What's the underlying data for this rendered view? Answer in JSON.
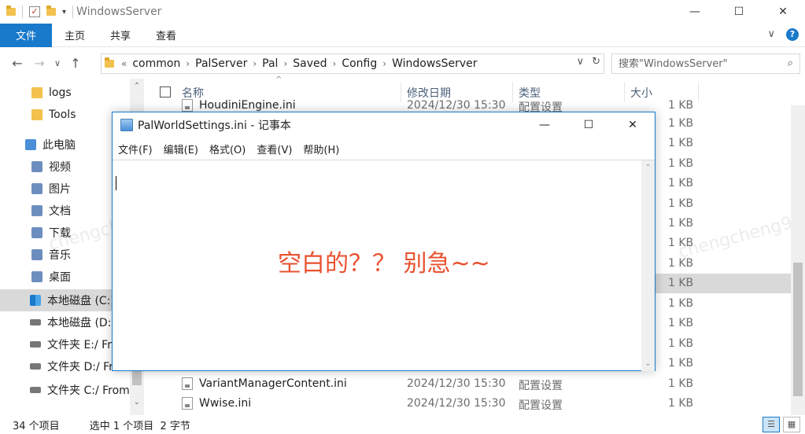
{
  "window": {
    "title": "WindowsServer",
    "minimize": "—",
    "maximize": "☐",
    "close": "✕"
  },
  "ribbon": {
    "tabs": [
      "文件",
      "主页",
      "共享",
      "查看"
    ],
    "expand": "∨",
    "help": "?"
  },
  "address": {
    "back": "←",
    "forward": "→",
    "recent": "∨",
    "up": "↑",
    "overflow": "«",
    "crumbs": [
      "common",
      "PalServer",
      "Pal",
      "Saved",
      "Config",
      "WindowsServer"
    ],
    "separator": "›",
    "dropdown": "∨",
    "refresh": "↻",
    "search_placeholder": "搜索\"WindowsServer\""
  },
  "nav": {
    "items": [
      {
        "label": "logs",
        "icon": "folder-icon"
      },
      {
        "label": "Tools",
        "icon": "folder-icon"
      },
      {
        "label": "此电脑",
        "icon": "computer-icon"
      },
      {
        "label": "视频",
        "icon": "videos-icon"
      },
      {
        "label": "图片",
        "icon": "pictures-icon"
      },
      {
        "label": "文档",
        "icon": "documents-icon"
      },
      {
        "label": "下载",
        "icon": "downloads-icon"
      },
      {
        "label": "音乐",
        "icon": "music-icon"
      },
      {
        "label": "桌面",
        "icon": "desktop-icon"
      },
      {
        "label": "本地磁盘 (C:)",
        "icon": "windows-drive-icon"
      },
      {
        "label": "本地磁盘 (D:)",
        "icon": "drive-icon"
      },
      {
        "label": "文件夹 E:/ Fr",
        "icon": "network-drive-icon"
      },
      {
        "label": "文件夹 D:/ Fr",
        "icon": "network-drive-icon"
      },
      {
        "label": "文件夹 C:/ From",
        "icon": "network-drive-icon"
      }
    ]
  },
  "filelist": {
    "columns": {
      "name": "名称",
      "date": "修改日期",
      "type": "类型",
      "size": "大小"
    },
    "rows": [
      {
        "name": "HoudiniEngine.ini",
        "date": "2024/12/30 15:30",
        "type": "配置设置",
        "size": "1 KB"
      },
      {
        "name": "",
        "date": "",
        "type": "",
        "size": "1 KB"
      },
      {
        "name": "",
        "date": "",
        "type": "",
        "size": "1 KB"
      },
      {
        "name": "",
        "date": "",
        "type": "",
        "size": "1 KB"
      },
      {
        "name": "",
        "date": "",
        "type": "",
        "size": "1 KB"
      },
      {
        "name": "",
        "date": "",
        "type": "",
        "size": "1 KB"
      },
      {
        "name": "",
        "date": "",
        "type": "",
        "size": "1 KB"
      },
      {
        "name": "",
        "date": "",
        "type": "",
        "size": "1 KB"
      },
      {
        "name": "",
        "date": "",
        "type": "",
        "size": "1 KB"
      },
      {
        "name": "",
        "date": "",
        "type": "",
        "size": "1 KB"
      },
      {
        "name": "",
        "date": "",
        "type": "",
        "size": "1 KB"
      },
      {
        "name": "",
        "date": "",
        "type": "",
        "size": "1 KB"
      },
      {
        "name": "",
        "date": "",
        "type": "",
        "size": "1 KB"
      },
      {
        "name": "",
        "date": "",
        "type": "",
        "size": "1 KB"
      },
      {
        "name": "VariantManagerContent.ini",
        "date": "2024/12/30 15:30",
        "type": "配置设置",
        "size": "1 KB"
      },
      {
        "name": "Wwise.ini",
        "date": "2024/12/30 15:30",
        "type": "配置设置",
        "size": "1 KB"
      }
    ]
  },
  "status": {
    "count": "34 个项目",
    "selection": "选中 1 个项目  2 字节"
  },
  "notepad": {
    "title": "PalWorldSettings.ini - 记事本",
    "menu": [
      "文件(F)",
      "编辑(E)",
      "格式(O)",
      "查看(V)",
      "帮助(H)"
    ],
    "minimize": "—",
    "maximize": "☐",
    "close": "✕",
    "annotation": "空白的？？ 别急~~"
  },
  "watermark": "chengcheng9"
}
